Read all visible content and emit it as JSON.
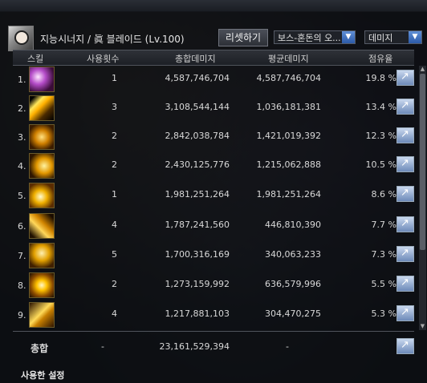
{
  "header": {
    "character": "지능시너지 / 眞 블레이드 (Lv.100)",
    "reset_label": "리셋하기",
    "filter1": "보스-혼돈의 오...",
    "filter2": "데미지"
  },
  "columns": {
    "skill": "스킬",
    "uses": "사용횟수",
    "total": "총합데미지",
    "avg": "평균데미지",
    "share": "점유율"
  },
  "rows": [
    {
      "rank": "1.",
      "uses": "1",
      "total": "4,587,746,704",
      "avg": "4,587,746,704",
      "share": "19.8 %"
    },
    {
      "rank": "2.",
      "uses": "3",
      "total": "3,108,544,144",
      "avg": "1,036,181,381",
      "share": "13.4 %"
    },
    {
      "rank": "3.",
      "uses": "2",
      "total": "2,842,038,784",
      "avg": "1,421,019,392",
      "share": "12.3 %"
    },
    {
      "rank": "4.",
      "uses": "2",
      "total": "2,430,125,776",
      "avg": "1,215,062,888",
      "share": "10.5 %"
    },
    {
      "rank": "5.",
      "uses": "1",
      "total": "1,981,251,264",
      "avg": "1,981,251,264",
      "share": "8.6 %"
    },
    {
      "rank": "6.",
      "uses": "4",
      "total": "1,787,241,560",
      "avg": "446,810,390",
      "share": "7.7 %"
    },
    {
      "rank": "7.",
      "uses": "5",
      "total": "1,700,316,169",
      "avg": "340,063,233",
      "share": "7.3 %"
    },
    {
      "rank": "8.",
      "uses": "2",
      "total": "1,273,159,992",
      "avg": "636,579,996",
      "share": "5.5 %"
    },
    {
      "rank": "9.",
      "uses": "4",
      "total": "1,217,881,103",
      "avg": "304,470,275",
      "share": "5.3 %"
    }
  ],
  "total": {
    "label": "총합",
    "uses": "-",
    "total": "23,161,529,394",
    "avg": "-"
  },
  "footer": {
    "tab": "사용한 설정"
  }
}
